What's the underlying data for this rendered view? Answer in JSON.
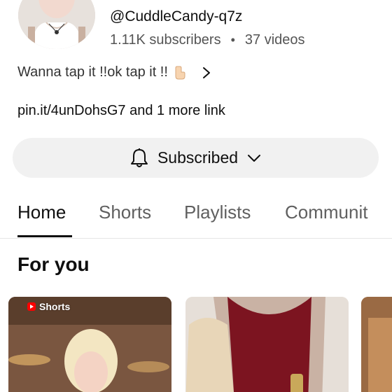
{
  "channel": {
    "handle": "@CuddleCandy-q7z",
    "subscribers": "1.11K subscribers",
    "separator": "•",
    "videos": "37 videos",
    "description": "Wanna tap it !!ok tap it !!",
    "links": "pin.it/4unDohsG7 and 1 more link"
  },
  "subscribe": {
    "label": "Subscribed"
  },
  "tabs": [
    {
      "label": "Home"
    },
    {
      "label": "Shorts"
    },
    {
      "label": "Playlists"
    },
    {
      "label": "Communit"
    }
  ],
  "section": {
    "title": "For you"
  },
  "cards": [
    {
      "badge": "Shorts"
    }
  ],
  "colors": {
    "accent_red": "#ff0000",
    "text_primary": "#0f0f0f",
    "text_secondary": "#606060",
    "button_bg": "#f1f1f1"
  },
  "icons": {
    "description_emoji": "pointing-hand-icon",
    "description_more": "chevron-right-icon",
    "subscribe_bell": "bell-icon",
    "subscribe_dropdown": "chevron-down-icon",
    "shorts_logo": "shorts-logo-icon"
  }
}
